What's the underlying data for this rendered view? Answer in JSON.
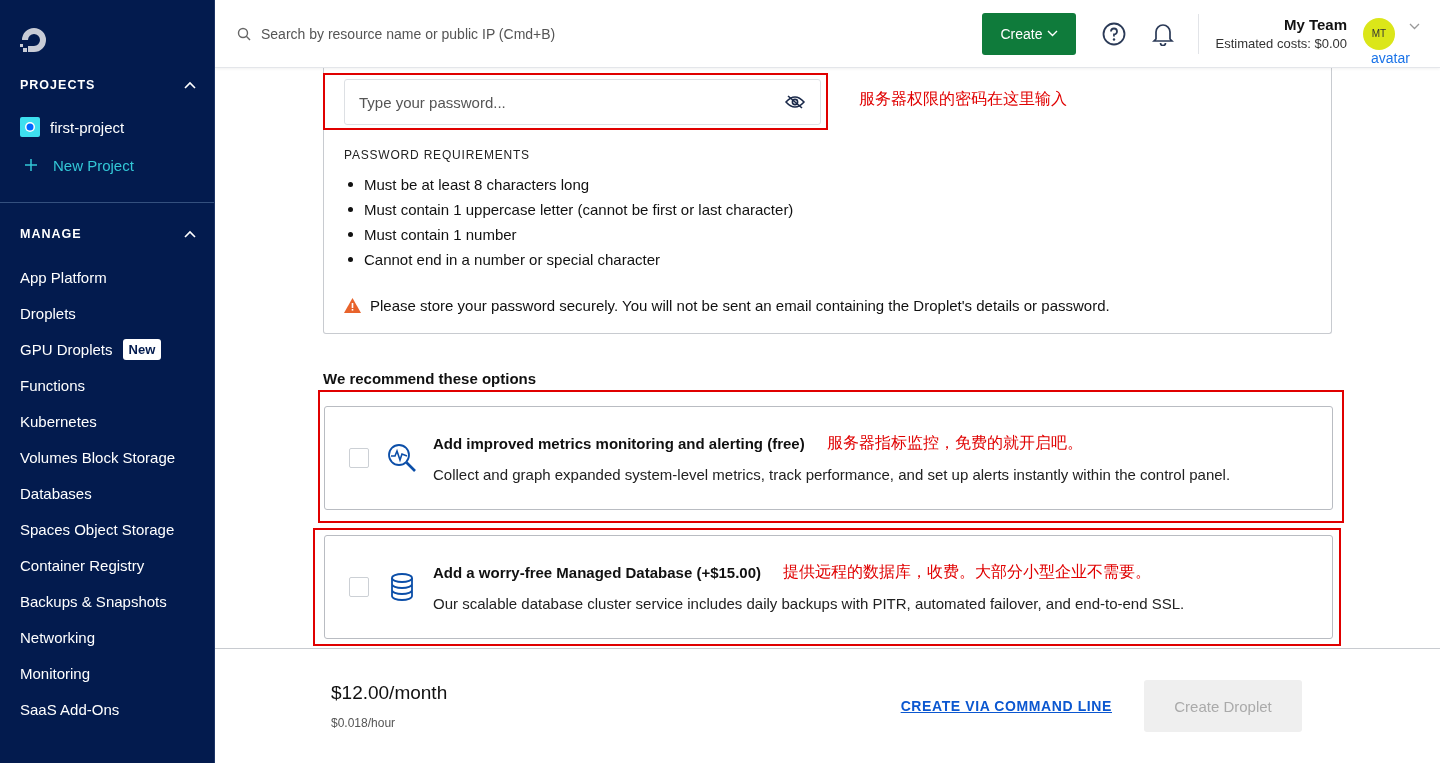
{
  "sidebar": {
    "sections": [
      {
        "title": "PROJECTS",
        "expanded": true,
        "items": [
          {
            "kind": "project",
            "label": "first-project"
          },
          {
            "kind": "add",
            "label": "New Project"
          }
        ]
      },
      {
        "title": "MANAGE",
        "expanded": true,
        "items": [
          {
            "kind": "link",
            "label": "App Platform"
          },
          {
            "kind": "link",
            "label": "Droplets"
          },
          {
            "kind": "link",
            "label": "GPU Droplets",
            "badge": "New"
          },
          {
            "kind": "link",
            "label": "Functions"
          },
          {
            "kind": "link",
            "label": "Kubernetes"
          },
          {
            "kind": "link",
            "label": "Volumes Block Storage"
          },
          {
            "kind": "link",
            "label": "Databases"
          },
          {
            "kind": "link",
            "label": "Spaces Object Storage"
          },
          {
            "kind": "link",
            "label": "Container Registry"
          },
          {
            "kind": "link",
            "label": "Backups & Snapshots"
          },
          {
            "kind": "link",
            "label": "Networking"
          },
          {
            "kind": "link",
            "label": "Monitoring"
          },
          {
            "kind": "link",
            "label": "SaaS Add-Ons"
          }
        ]
      }
    ]
  },
  "header": {
    "search_placeholder": "Search by resource name or public IP (Cmd+B)",
    "create_button": "Create",
    "team": "My Team",
    "costs": "Estimated costs: $0.00",
    "avatar_initials": "MT",
    "avatar_alt": "avatar"
  },
  "password": {
    "placeholder": "Type your password...",
    "annotation": "服务器权限的密码在这里输入",
    "requirements_title": "PASSWORD REQUIREMENTS",
    "requirements": [
      "Must be at least 8 characters long",
      "Must contain 1 uppercase letter (cannot be first or last character)",
      "Must contain 1 number",
      "Cannot end in a number or special character"
    ],
    "warning": "Please store your password securely. You will not be sent an email containing the Droplet's details or password."
  },
  "recommend": {
    "title": "We recommend these options",
    "options": [
      {
        "kind": "metrics",
        "checked": false,
        "title": "Add improved metrics monitoring and alerting (free)",
        "annotation": "服务器指标监控，免费的就开启吧。",
        "description": "Collect and graph expanded system-level metrics, track performance, and set up alerts instantly within the control panel."
      },
      {
        "kind": "database",
        "checked": false,
        "title": "Add a worry-free Managed Database (+$15.00)",
        "annotation": "提供远程的数据库，收费。大部分小型企业不需要。",
        "description": "Our scalable database cluster service includes daily backups with PITR, automated failover, and end-to-end SSL."
      }
    ]
  },
  "footer": {
    "price": "$12.00/month",
    "hourly": "$0.018/hour",
    "cli_link": "CREATE VIA COMMAND LINE",
    "create_button": {
      "label": "Create Droplet",
      "disabled": true
    }
  }
}
